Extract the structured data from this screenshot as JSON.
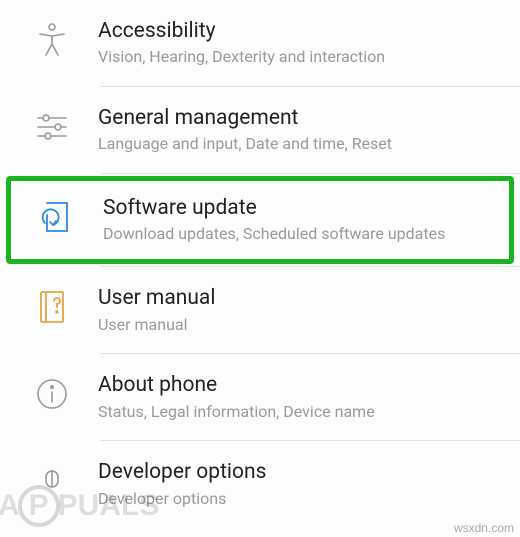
{
  "settings": {
    "items": [
      {
        "title": "Accessibility",
        "sub": "Vision, Hearing, Dexterity and interaction",
        "icon": "accessibility-icon",
        "highlighted": false
      },
      {
        "title": "General management",
        "sub": "Language and input, Date and time, Reset",
        "icon": "general-management-icon",
        "highlighted": false
      },
      {
        "title": "Software update",
        "sub": "Download updates, Scheduled software updates",
        "icon": "software-update-icon",
        "highlighted": true
      },
      {
        "title": "User manual",
        "sub": "User manual",
        "icon": "user-manual-icon",
        "highlighted": false
      },
      {
        "title": "About phone",
        "sub": "Status, Legal information, Device name",
        "icon": "about-phone-icon",
        "highlighted": false
      },
      {
        "title": "Developer options",
        "sub": "Developer options",
        "icon": "developer-options-icon",
        "highlighted": false
      }
    ]
  },
  "watermark": {
    "left": "APPUALS",
    "right": "wsxdn.com"
  },
  "colors": {
    "highlight_border": "#1bb422",
    "icon_blue": "#2b8be6",
    "icon_orange": "#e8a245",
    "icon_gray": "#9a9a9a"
  }
}
